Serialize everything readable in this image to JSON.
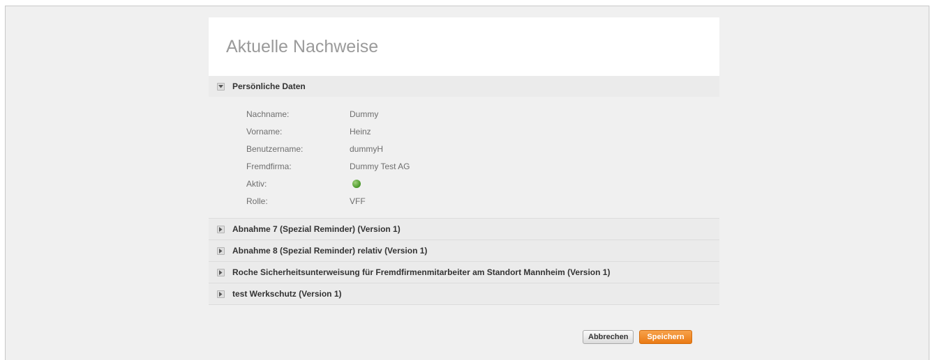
{
  "page": {
    "title": "Aktuelle Nachweise"
  },
  "personal": {
    "title": "Persönliche Daten",
    "fields": [
      {
        "label": "Nachname:",
        "value": "Dummy"
      },
      {
        "label": "Vorname:",
        "value": "Heinz"
      },
      {
        "label": "Benutzername:",
        "value": "dummyH"
      },
      {
        "label": "Fremdfirma:",
        "value": "Dummy Test AG"
      },
      {
        "label": "Aktiv:",
        "status": "active",
        "status_color": "#4d9a2c"
      },
      {
        "label": "Rolle:",
        "value": "VFF"
      }
    ]
  },
  "sections": [
    {
      "title": "Abnahme 7 (Spezial Reminder) (Version 1)"
    },
    {
      "title": "Abnahme 8 (Spezial Reminder) relativ (Version 1)"
    },
    {
      "title": "Roche Sicherheitsunterweisung für Fremdfirmenmitarbeiter am Standort Mannheim (Version 1)"
    },
    {
      "title": "test Werkschutz (Version 1)"
    }
  ],
  "actions": {
    "cancel_label": "Abbrechen",
    "save_label": "Speichern",
    "save_color": "#ea7a14"
  }
}
